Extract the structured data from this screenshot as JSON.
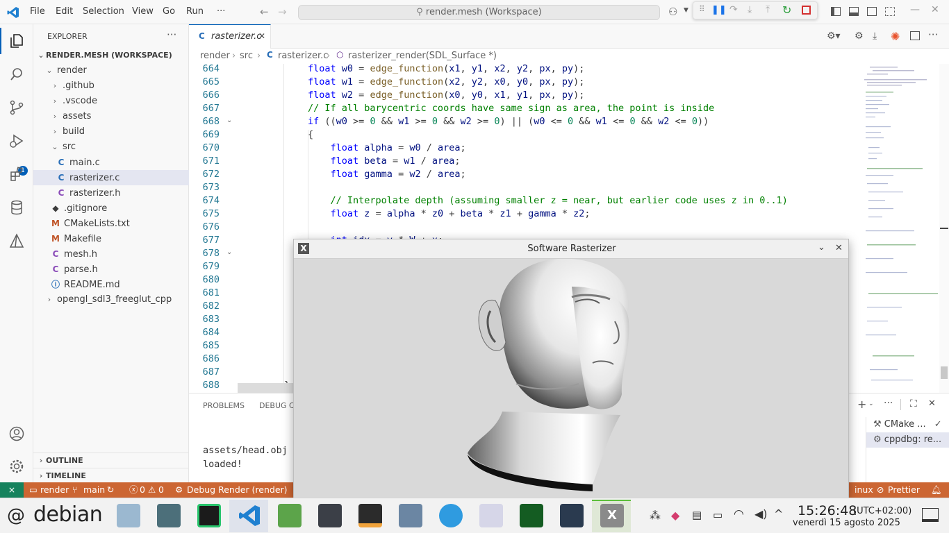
{
  "titlebar": {
    "menu": [
      "File",
      "Edit",
      "Selection",
      "View",
      "Go",
      "Run",
      "···"
    ],
    "command_center": "render.mesh (Workspace)"
  },
  "sidebar": {
    "title": "EXPLORER",
    "workspace": "RENDER.MESH (WORKSPACE)",
    "tree": [
      {
        "label": "render",
        "indent": 1,
        "kind": "folder-open"
      },
      {
        "label": ".github",
        "indent": 2,
        "kind": "folder"
      },
      {
        "label": ".vscode",
        "indent": 2,
        "kind": "folder"
      },
      {
        "label": "assets",
        "indent": 2,
        "kind": "folder"
      },
      {
        "label": "build",
        "indent": 2,
        "kind": "folder"
      },
      {
        "label": "src",
        "indent": 2,
        "kind": "folder-open"
      },
      {
        "label": "main.c",
        "indent": 3,
        "kind": "c"
      },
      {
        "label": "rasterizer.c",
        "indent": 3,
        "kind": "c"
      },
      {
        "label": "rasterizer.h",
        "indent": 3,
        "kind": "h"
      },
      {
        "label": ".gitignore",
        "indent": 2,
        "kind": "git"
      },
      {
        "label": "CMakeLists.txt",
        "indent": 2,
        "kind": "cmake"
      },
      {
        "label": "Makefile",
        "indent": 2,
        "kind": "make"
      },
      {
        "label": "mesh.h",
        "indent": 2,
        "kind": "h"
      },
      {
        "label": "parse.h",
        "indent": 2,
        "kind": "h"
      },
      {
        "label": "README.md",
        "indent": 2,
        "kind": "info"
      },
      {
        "label": "opengl_sdl3_freeglut_cpp",
        "indent": 1,
        "kind": "folder"
      }
    ],
    "outline": "OUTLINE",
    "timeline": "TIMELINE"
  },
  "activity": {
    "debug_badge": "1"
  },
  "editor": {
    "tab": "rasterizer.c",
    "breadcrumb": [
      "render",
      "src",
      "rasterizer.c",
      "rasterizer_render(SDL_Surface *)"
    ],
    "line_numbers": [
      "664",
      "665",
      "666",
      "667",
      "668",
      "669",
      "670",
      "671",
      "672",
      "673",
      "674",
      "675",
      "676",
      "677",
      "678",
      "679",
      "680",
      "681",
      "682",
      "683",
      "684",
      "685",
      "686",
      "687",
      "688"
    ],
    "lines": [
      "float w0 = edge_function(x1, y1, x2, y2, px, py);",
      "float w1 = edge_function(x2, y2, x0, y0, px, py);",
      "float w2 = edge_function(x0, y0, x1, y1, px, py);",
      "// If all barycentric coords have same sign as area, the point is inside",
      "if ((w0 >= 0 && w1 >= 0 && w2 >= 0) || (w0 <= 0 && w1 <= 0 && w2 <= 0))",
      "{",
      "    float alpha = w0 / area;",
      "    float beta = w1 / area;",
      "    float gamma = w2 / area;",
      "",
      "    // Interpolate depth (assuming smaller z = near, but earlier code uses z in 0..1)",
      "    float z = alpha * z0 + beta * z1 + gamma * z2;",
      "",
      "    int idx = y * W + x;",
      "",
      "",
      "",
      "",
      "",
      "",
      "",
      "",
      "",
      "",
      "}"
    ]
  },
  "panel": {
    "tabs": [
      "PROBLEMS",
      "DEBUG CO"
    ],
    "output": [
      "assets/head.obj",
      "loaded!"
    ],
    "side_items": [
      "CMake ...",
      "cppdbg: re..."
    ]
  },
  "statusbar": {
    "project": "render",
    "branch": "main",
    "errors": "0",
    "warnings": "0",
    "debug": "Debug Render (render)",
    "right_partial": "inux",
    "prettier": "Prettier"
  },
  "sdl_window": {
    "title": "Software Rasterizer"
  },
  "taskbar": {
    "start_label": "debian",
    "time": "15:26:48",
    "timezone": "(UTC+02:00)",
    "date": "venerdì 15 agosto 2025"
  },
  "colors": {
    "accent": "#005fb8",
    "statusbar": "#cc6633"
  }
}
